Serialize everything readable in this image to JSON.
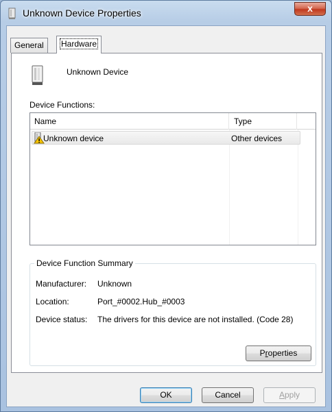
{
  "window": {
    "title": "Unknown Device Properties",
    "close_glyph": "x",
    "accent_color": "#c0391f"
  },
  "tabs": [
    {
      "label": "General"
    },
    {
      "label": "Hardware",
      "active": true
    }
  ],
  "device": {
    "name": "Unknown Device",
    "icon": "device-icon"
  },
  "functions": {
    "label": "Device Functions:",
    "columns": [
      "Name",
      "Type"
    ],
    "rows": [
      {
        "name": "Unknown device",
        "type": "Other devices",
        "icon": "unknown-device-warning-icon"
      }
    ]
  },
  "summary": {
    "title": "Device Function Summary",
    "manufacturer_label": "Manufacturer:",
    "manufacturer": "Unknown",
    "location_label": "Location:",
    "location": "Port_#0002.Hub_#0003",
    "status_label": "Device status:",
    "status": "The drivers for this device are not installed. (Code 28)",
    "properties_button_pre": "P",
    "properties_button_accel": "r",
    "properties_button_post": "operties"
  },
  "buttons": {
    "ok": "OK",
    "cancel": "Cancel",
    "apply_accel": "A",
    "apply_post": "pply"
  }
}
